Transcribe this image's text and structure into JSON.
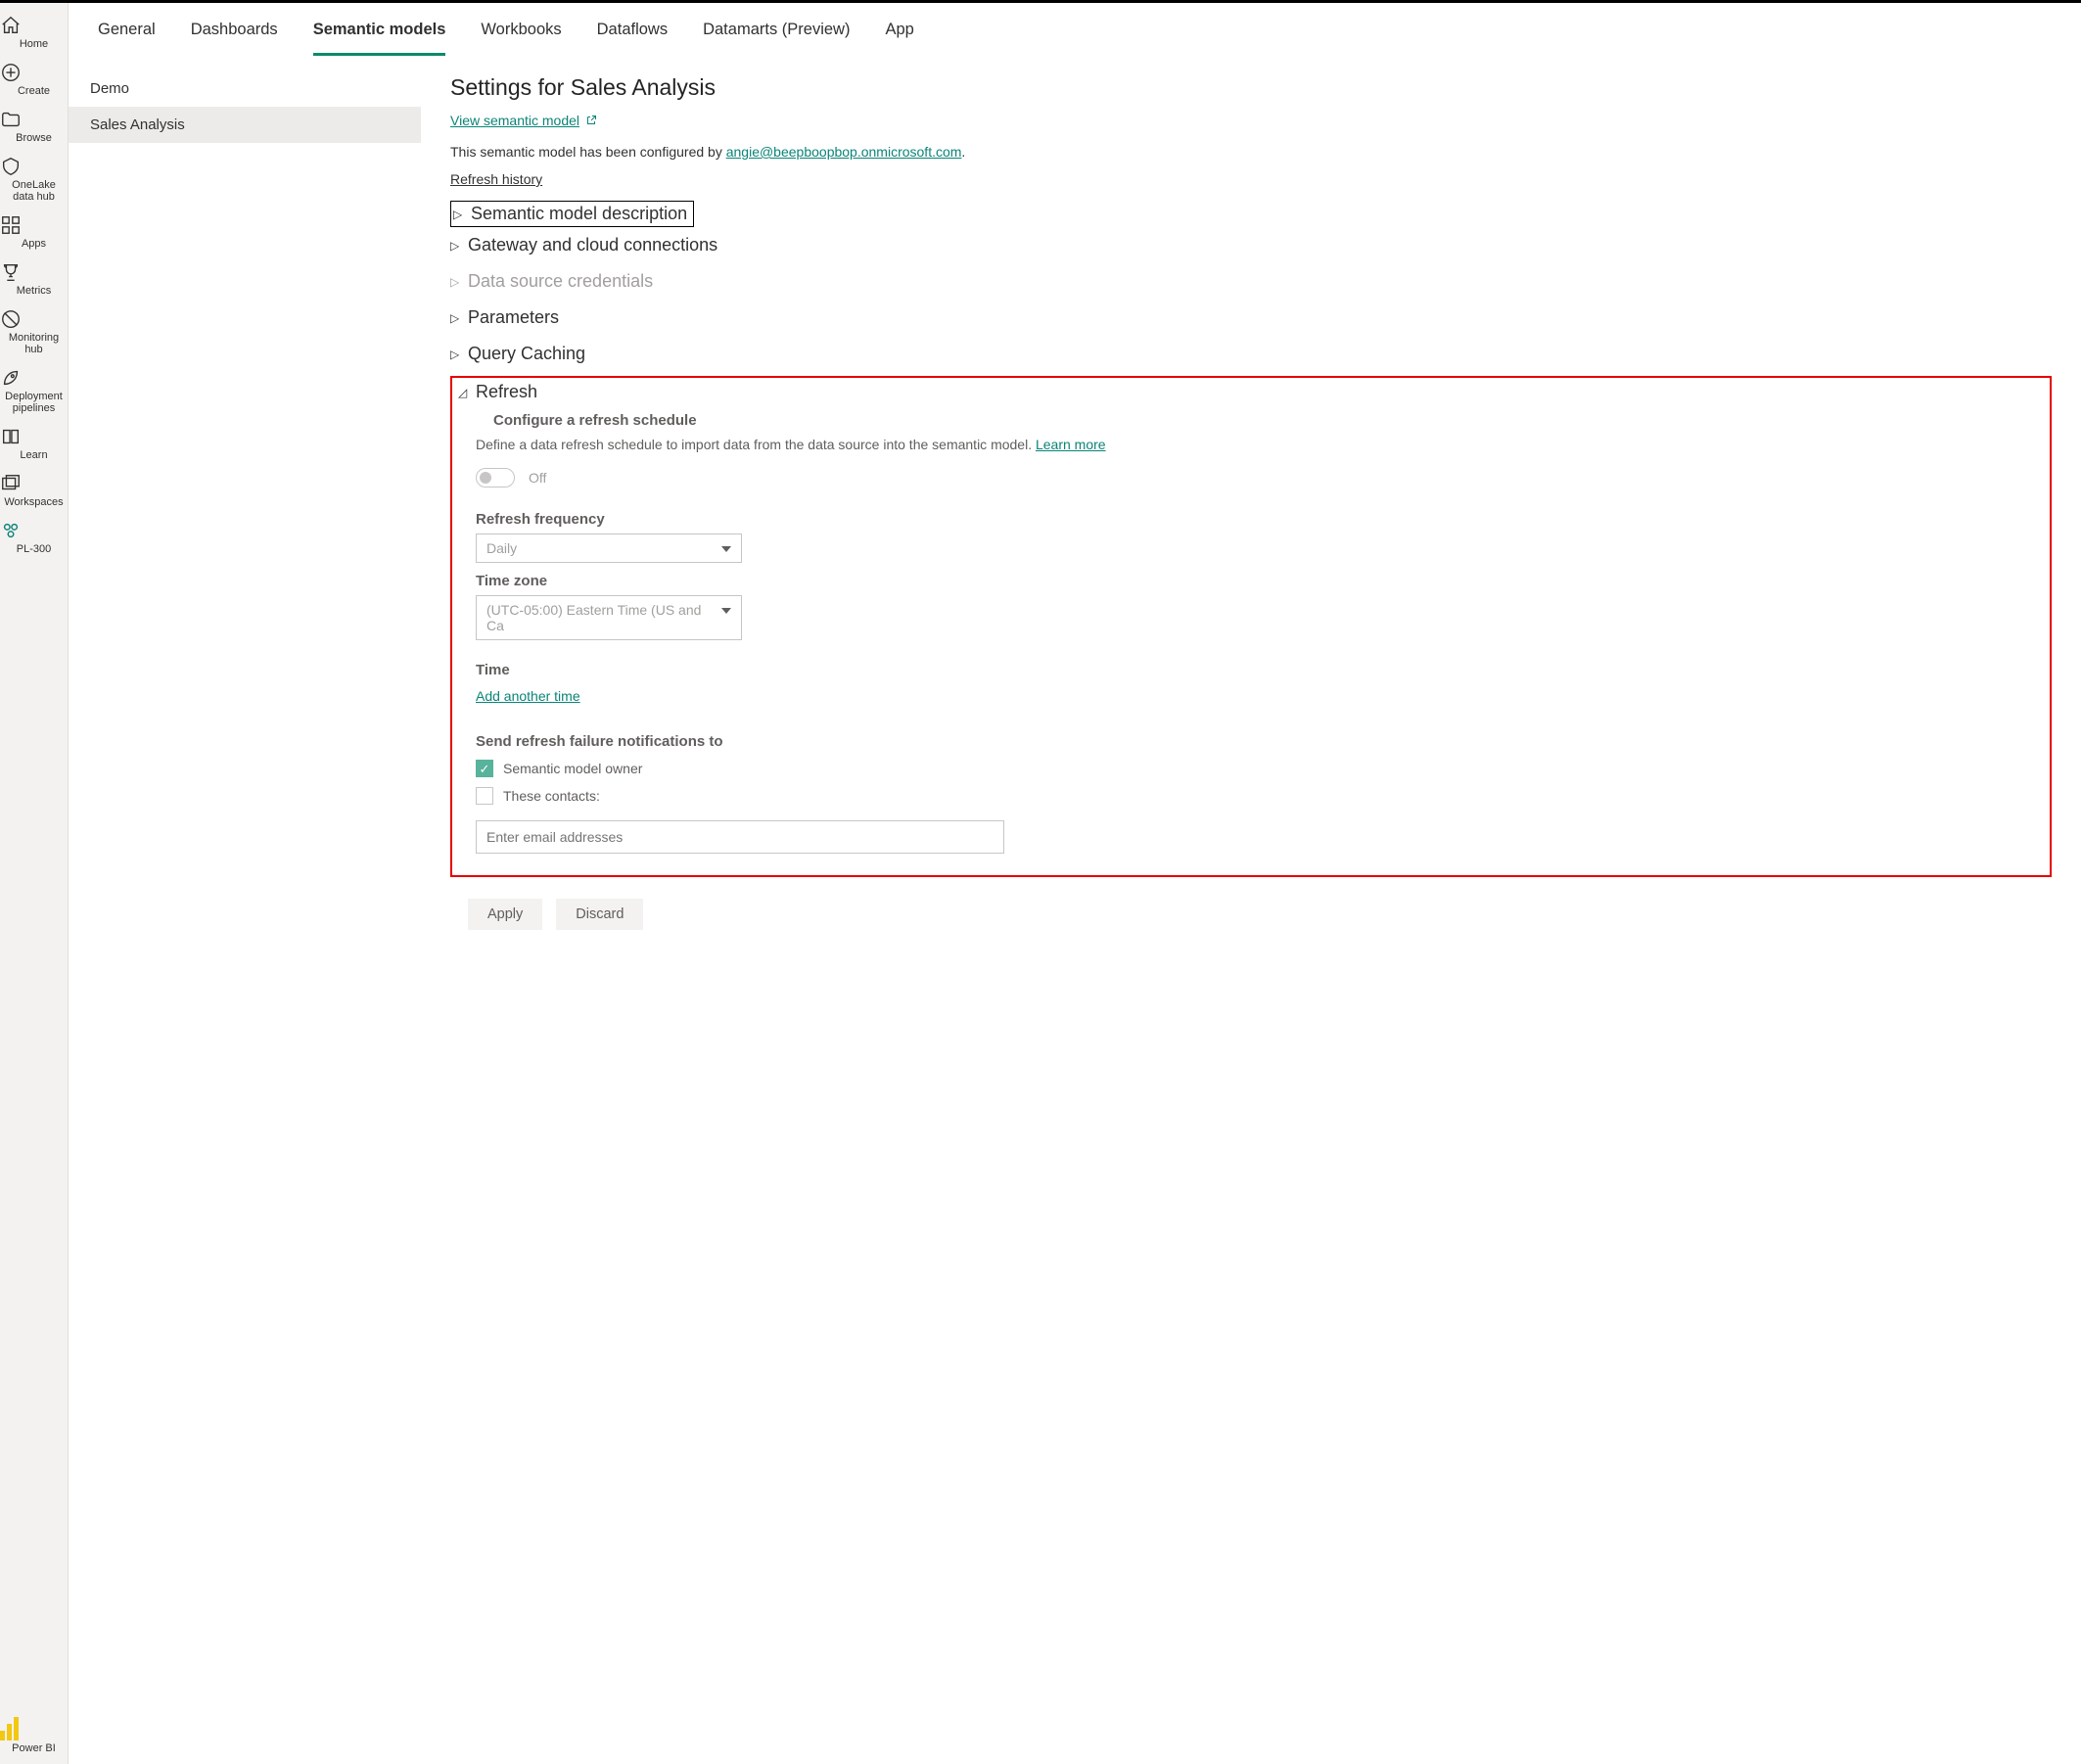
{
  "nav": {
    "items": [
      {
        "label": "Home"
      },
      {
        "label": "Create"
      },
      {
        "label": "Browse"
      },
      {
        "label": "OneLake data hub"
      },
      {
        "label": "Apps"
      },
      {
        "label": "Metrics"
      },
      {
        "label": "Monitoring hub"
      },
      {
        "label": "Deployment pipelines"
      },
      {
        "label": "Learn"
      },
      {
        "label": "Workspaces"
      },
      {
        "label": "PL-300"
      }
    ],
    "brand": "Power BI"
  },
  "tabs": [
    {
      "label": "General"
    },
    {
      "label": "Dashboards"
    },
    {
      "label": "Semantic models"
    },
    {
      "label": "Workbooks"
    },
    {
      "label": "Dataflows"
    },
    {
      "label": "Datamarts (Preview)"
    },
    {
      "label": "App"
    }
  ],
  "list": {
    "items": [
      {
        "label": "Demo"
      },
      {
        "label": "Sales Analysis"
      }
    ]
  },
  "detail": {
    "title": "Settings for Sales Analysis",
    "view_link": "View semantic model",
    "configured_prefix": "This semantic model has been configured by ",
    "configured_email": "angie@beepboopbop.onmicrosoft.com",
    "configured_suffix": ".",
    "refresh_history": "Refresh history",
    "accordions": {
      "description": "Semantic model description",
      "gateway": "Gateway and cloud connections",
      "credentials": "Data source credentials",
      "parameters": "Parameters",
      "caching": "Query Caching",
      "refresh": "Refresh"
    },
    "refresh": {
      "subheading": "Configure a refresh schedule",
      "desc": "Define a data refresh schedule to import data from the data source into the semantic model.  ",
      "learn_more": "Learn more",
      "toggle_label": "Off",
      "freq_label": "Refresh frequency",
      "freq_value": "Daily",
      "tz_label": "Time zone",
      "tz_value": "(UTC-05:00) Eastern Time (US and Ca",
      "time_label": "Time",
      "add_time": "Add another time",
      "notify_label": "Send refresh failure notifications to",
      "notify_owner": "Semantic model owner",
      "notify_contacts": "These contacts:",
      "email_placeholder": "Enter email addresses"
    },
    "buttons": {
      "apply": "Apply",
      "discard": "Discard"
    }
  }
}
